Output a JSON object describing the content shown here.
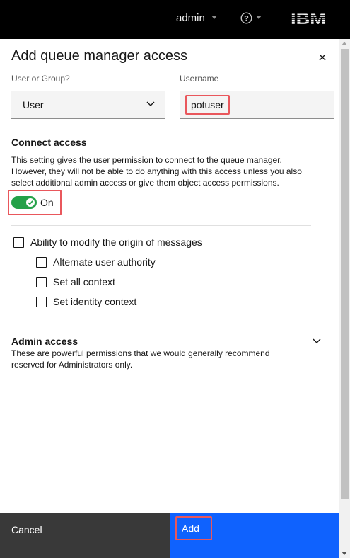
{
  "topbar": {
    "user_label": "admin",
    "help_icon": "question-circle-icon",
    "brand": "IBM",
    "background": "#000000"
  },
  "panel": {
    "title": "Add queue manager access",
    "close_icon": "close-icon"
  },
  "form": {
    "user_or_group_label": "User or Group?",
    "user_or_group_value": "User",
    "username_label": "Username",
    "username_value": "potuser"
  },
  "connect": {
    "heading": "Connect access",
    "description_line1": "This setting gives the user permission to connect to the queue manager.",
    "description_line2": "However, they will not be able to do anything with this access unless you also",
    "description_line3": "select additional admin access or give them object access permissions.",
    "toggle_label": "On",
    "toggle_on": true,
    "toggle_color": "#24a148"
  },
  "checkboxes": {
    "parent": "Ability to modify the origin of messages",
    "children": [
      "Alternate user authority",
      "Set all context",
      "Set identity context"
    ]
  },
  "admin": {
    "heading": "Admin access",
    "description_line1": "These are powerful permissions that we would generally recommend",
    "description_line2": "reserved for Administrators only."
  },
  "buttons": {
    "cancel": "Cancel",
    "add": "Add",
    "cancel_color": "#393939",
    "add_color": "#0f62fe"
  },
  "colors": {
    "highlight": "#e9575c"
  }
}
